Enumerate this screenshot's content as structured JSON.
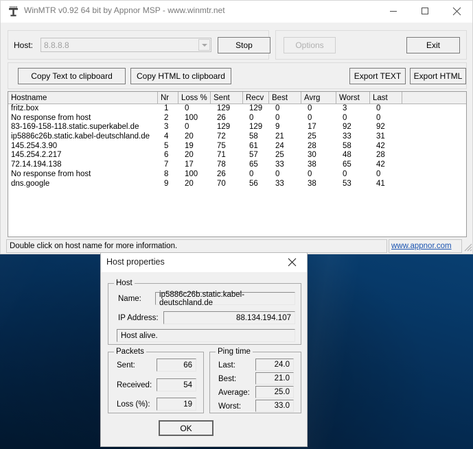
{
  "window": {
    "title": "WinMTR v0.92 64 bit by Appnor MSP - www.winmtr.net",
    "icon": "winmtr-tower-icon",
    "minimize_label": "─",
    "maximize_label": "☐",
    "close_label": "✕"
  },
  "toolbar": {
    "host_label": "Host:",
    "host_value": "8.8.8.8",
    "host_placeholder": "8.8.8.8",
    "stop_label": "Stop",
    "options_label": "Options",
    "exit_label": "Exit",
    "copy_text_label": "Copy Text to clipboard",
    "copy_html_label": "Copy HTML to clipboard",
    "export_text_label": "Export TEXT",
    "export_html_label": "Export HTML"
  },
  "table": {
    "columns": [
      "Hostname",
      "Nr",
      "Loss %",
      "Sent",
      "Recv",
      "Best",
      "Avrg",
      "Worst",
      "Last"
    ],
    "rows": [
      {
        "hostname": "fritz.box",
        "nr": "1",
        "loss": "0",
        "sent": "129",
        "recv": "129",
        "best": "0",
        "avrg": "0",
        "worst": "3",
        "last": "0"
      },
      {
        "hostname": "No response from host",
        "nr": "2",
        "loss": "100",
        "sent": "26",
        "recv": "0",
        "best": "0",
        "avrg": "0",
        "worst": "0",
        "last": "0"
      },
      {
        "hostname": "83-169-158-118.static.superkabel.de",
        "nr": "3",
        "loss": "0",
        "sent": "129",
        "recv": "129",
        "best": "9",
        "avrg": "17",
        "worst": "92",
        "last": "92"
      },
      {
        "hostname": "ip5886c26b.static.kabel-deutschland.de",
        "nr": "4",
        "loss": "20",
        "sent": "72",
        "recv": "58",
        "best": "21",
        "avrg": "25",
        "worst": "33",
        "last": "31"
      },
      {
        "hostname": "145.254.3.90",
        "nr": "5",
        "loss": "19",
        "sent": "75",
        "recv": "61",
        "best": "24",
        "avrg": "28",
        "worst": "58",
        "last": "42"
      },
      {
        "hostname": "145.254.2.217",
        "nr": "6",
        "loss": "20",
        "sent": "71",
        "recv": "57",
        "best": "25",
        "avrg": "30",
        "worst": "48",
        "last": "28"
      },
      {
        "hostname": "72.14.194.138",
        "nr": "7",
        "loss": "17",
        "sent": "78",
        "recv": "65",
        "best": "33",
        "avrg": "38",
        "worst": "65",
        "last": "42"
      },
      {
        "hostname": "No response from host",
        "nr": "8",
        "loss": "100",
        "sent": "26",
        "recv": "0",
        "best": "0",
        "avrg": "0",
        "worst": "0",
        "last": "0"
      },
      {
        "hostname": "dns.google",
        "nr": "9",
        "loss": "20",
        "sent": "70",
        "recv": "56",
        "best": "33",
        "avrg": "38",
        "worst": "53",
        "last": "41"
      }
    ]
  },
  "statusbar": {
    "hint": "Double click on host name for more information.",
    "link": "www.appnor.com"
  },
  "dialog": {
    "title": "Host properties",
    "close_label": "✕",
    "host_group": {
      "legend": "Host",
      "name_label": "Name:",
      "name_value": "ip5886c26b.static.kabel-deutschland.de",
      "ip_label": "IP Address:",
      "ip_value": "88.134.194.107",
      "status_value": "Host alive."
    },
    "packets_group": {
      "legend": "Packets",
      "sent_label": "Sent:",
      "sent_value": "66",
      "received_label": "Received:",
      "received_value": "54",
      "loss_label": "Loss (%):",
      "loss_value": "19"
    },
    "ping_group": {
      "legend": "Ping time",
      "last_label": "Last:",
      "last_value": "24.0",
      "best_label": "Best:",
      "best_value": "21.0",
      "average_label": "Average:",
      "average_value": "25.0",
      "worst_label": "Worst:",
      "worst_value": "33.0"
    },
    "ok_label": "OK"
  },
  "colors": {
    "window_face": "#f0f0f0",
    "link": "#1a53b0",
    "desktop": "#0c4a80"
  }
}
